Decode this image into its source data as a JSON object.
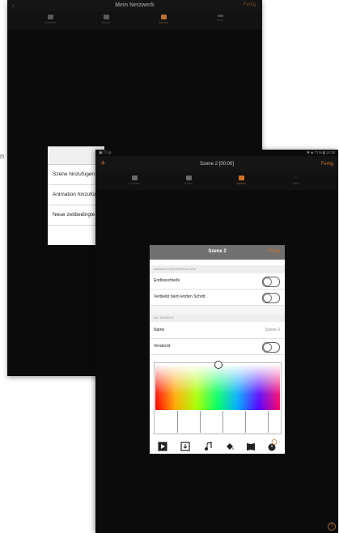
{
  "back_tablet": {
    "title": "Mein Netzwerk",
    "done_label": "Fertig",
    "back_glyph": "‹",
    "tabs": [
      {
        "label": "Leuchten",
        "icon": "lamp-icon",
        "active": false
      },
      {
        "label": "Szene",
        "icon": "scene-icon",
        "active": false
      },
      {
        "label": "Szenen",
        "icon": "scenes-icon",
        "active": true
      },
      {
        "label": "Mehr",
        "icon": "more-icon",
        "active": false
      }
    ],
    "menu_items": [
      "Szene hinzufügen",
      "Animation hinzufügen",
      "Neue zeitbedingte Szene"
    ],
    "side_glyph": "n"
  },
  "front_tablet": {
    "status_left": "▣ ⛉ ◎",
    "status_right": "✱ ◈ 71% ▮ 14:29",
    "title": "Szene 2 [00:00]",
    "done_label": "Fertig",
    "add_glyph": "+",
    "tabs": [
      {
        "label": "Leuchten",
        "icon": "lamp-icon",
        "active": false
      },
      {
        "label": "Szene",
        "icon": "scene-icon",
        "active": false
      },
      {
        "label": "Szenen",
        "icon": "scenes-icon",
        "active": true
      },
      {
        "label": "Mehr",
        "icon": "more-icon",
        "active": false
      }
    ],
    "help_glyph": "?"
  },
  "dialog": {
    "title": "Szene 2",
    "done_label": "Fertig",
    "section_animation": "ANIMATIONSVERHALTEN",
    "loop_label": "Endlosschleife",
    "loop_on": false,
    "stay_label": "Verbleibt beim letzten Schritt",
    "stay_on": false,
    "section_general": "ALLGEMEIN",
    "name_label": "Name",
    "name_value": "Szene 2",
    "hidden_label": "Versteckt",
    "hidden_on": false,
    "toolbar_icons": [
      "play-icon",
      "import-icon",
      "music-icon",
      "paint-bucket-icon",
      "book-icon",
      "timer-icon"
    ]
  },
  "colors": {
    "accent": "#d07028",
    "tablet_bg": "#0b0b0b",
    "dialog_header": "#707070"
  }
}
